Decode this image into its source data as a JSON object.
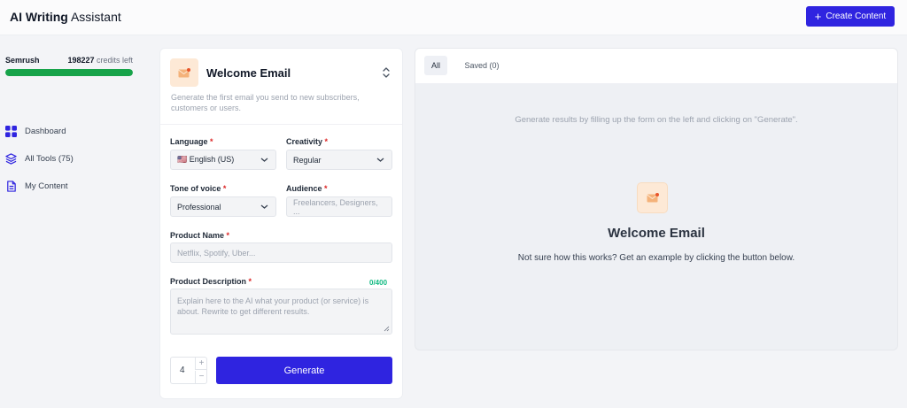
{
  "header": {
    "title_bold": "AI Writing",
    "title_rest": " Assistant",
    "create_label": "Create Content"
  },
  "sidebar": {
    "brand": "Semrush",
    "credits": "198227",
    "credits_suffix": " credits left",
    "credits_fraction": 1.0,
    "nav": [
      {
        "label": "Dashboard",
        "icon": "grid-icon"
      },
      {
        "label": "All Tools (75)",
        "icon": "layers-icon"
      },
      {
        "label": "My Content",
        "icon": "document-icon"
      }
    ]
  },
  "tool": {
    "title": "Welcome Email",
    "description": "Generate the first email you send to new subscribers, customers or users.",
    "icon": "envelope-icon"
  },
  "form": {
    "language": {
      "label": "Language",
      "value": "🇺🇸 English (US)"
    },
    "creativity": {
      "label": "Creativity",
      "value": "Regular"
    },
    "tone": {
      "label": "Tone of voice",
      "value": "Professional"
    },
    "audience": {
      "label": "Audience",
      "placeholder": "Freelancers, Designers, ..."
    },
    "product_name": {
      "label": "Product Name",
      "placeholder": "Netflix, Spotify, Uber..."
    },
    "product_description": {
      "label": "Product Description",
      "counter": "0/400",
      "placeholder": "Explain here to the AI what your product (or service) is about. Rewrite to get different results."
    },
    "required_mark": "*",
    "quantity": "4",
    "generate_label": "Generate"
  },
  "results": {
    "tabs": [
      {
        "label": "All"
      },
      {
        "label": "Saved (0)"
      }
    ],
    "hint": "Generate results by filling up the form on the left and clicking on \"Generate\".",
    "title": "Welcome Email",
    "subtitle": "Not sure how this works? Get an example by clicking the button below."
  },
  "colors": {
    "accent": "#2f24e0",
    "success": "#17a34a",
    "required": "#dc2626"
  }
}
